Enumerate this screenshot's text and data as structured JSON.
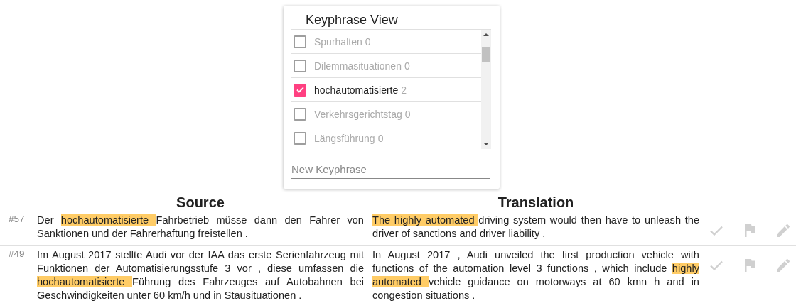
{
  "keyphrase_panel": {
    "title": "Keyphrase View",
    "items": [
      {
        "label": "Spurhalten",
        "count": "0",
        "checked": false
      },
      {
        "label": "Dilemmasituationen",
        "count": "0",
        "checked": false
      },
      {
        "label": "hochautomatisierte",
        "count": "2",
        "checked": true
      },
      {
        "label": "Verkehrsgerichtstag",
        "count": "0",
        "checked": false
      },
      {
        "label": "Längsführung",
        "count": "0",
        "checked": false
      }
    ],
    "new_keyphrase": {
      "placeholder": "New Keyphrase"
    }
  },
  "columns": [
    "Source",
    "Translation"
  ],
  "rows": [
    {
      "number": "#57",
      "source": [
        {
          "text": "Der ",
          "highlighted": false
        },
        {
          "text": "hochautomatisierte ",
          "highlighted": true
        },
        {
          "text": "Fahrbetrieb müsse dann den Fahrer von Sanktionen und der Fahrerhaftung freistellen .",
          "highlighted": false
        }
      ],
      "translation": [
        {
          "text": "The highly automated ",
          "highlighted": true
        },
        {
          "text": "driving system would then have to unleash the driver of sanctions and driver liability .",
          "highlighted": false
        }
      ]
    },
    {
      "number": "#49",
      "source": [
        {
          "text": "Im August 2017 stellte Audi vor der IAA das erste Serienfahrzeug mit Funktionen der Automatisierungsstufe 3 vor , diese umfassen die ",
          "highlighted": false
        },
        {
          "text": "hochautomatisierte ",
          "highlighted": true
        },
        {
          "text": "Führung des Fahrzeuges auf Autobahnen bei Geschwindigkeiten unter 60 km/h und in Stausituationen .",
          "highlighted": false
        }
      ],
      "translation": [
        {
          "text": "In August 2017 , Audi unveiled the first production vehicle with functions of the automation level 3 functions , which include ",
          "highlighted": false
        },
        {
          "text": "highly automated ",
          "highlighted": true
        },
        {
          "text": "vehicle guidance on motorways at 60 kmn h and in congestion situations .",
          "highlighted": false
        }
      ]
    }
  ]
}
